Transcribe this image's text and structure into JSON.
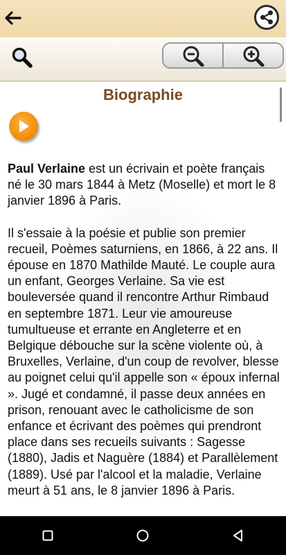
{
  "header": {
    "back_icon": "arrow-left-icon",
    "share_icon": "share-icon"
  },
  "toolbar": {
    "search_icon": "search-icon",
    "zoom_out_icon": "zoom-out-icon",
    "zoom_in_icon": "zoom-in-icon"
  },
  "main": {
    "title": "Biographie",
    "play_icon": "play-icon",
    "intro_name": "Paul Verlaine",
    "intro_rest": " est un écrivain et poète français né le 30 mars 1844 à Metz (Moselle) et mort le 8 janvier 1896 à Paris.",
    "paragraph2": "Il s'essaie à la poésie et publie son premier recueil, Poèmes saturniens, en 1866, à 22 ans. Il épouse en 1870 Mathilde Mauté. Le couple aura un enfant, Georges Verlaine. Sa vie est bouleversée quand il rencontre Arthur Rimbaud en septembre 1871. Leur vie amoureuse tumultueuse et errante en Angleterre et en Belgique débouche sur la scène violente où, à Bruxelles, Verlaine, d'un coup de revolver, blesse au poignet celui qu'il appelle son « époux infernal ». Jugé et condamné, il passe deux années en prison, renouant avec le catholicisme de son enfance et écrivant des poèmes qui prendront place dans ses recueils suivants : Sagesse (1880), Jadis et Naguère (1884) et Parallèlement (1889). Usé par l'alcool et la maladie, Verlaine meurt à 51 ans, le 8 janvier 1896 à Paris."
  },
  "navbar": {
    "icons": [
      "recent-apps-icon",
      "home-icon",
      "back-triangle-icon"
    ]
  },
  "colors": {
    "header_bg": "#f2dfb4",
    "title": "#7a4a1e",
    "play": "#f08a00"
  }
}
